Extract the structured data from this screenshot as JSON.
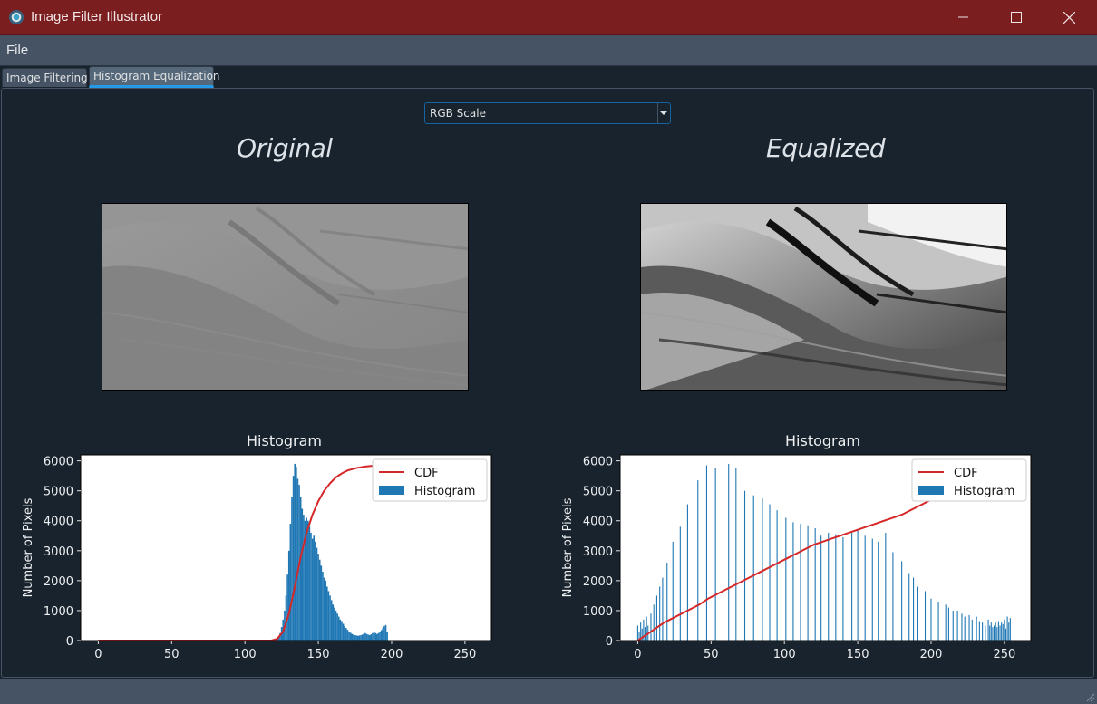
{
  "window": {
    "title": "Image Filter Illustrator"
  },
  "menu": {
    "file": "File"
  },
  "tabs": [
    {
      "label": "Image Filtering",
      "active": false
    },
    {
      "label": "Histogram Equalization",
      "active": true
    }
  ],
  "scale_select": {
    "value": "RGB Scale"
  },
  "panels": {
    "original": {
      "heading": "Original",
      "histogram_title": "Histogram"
    },
    "equalized": {
      "heading": "Equalized",
      "histogram_title": "Histogram"
    }
  },
  "colors": {
    "titlebar": "#7a1e20",
    "accent": "#259ae9",
    "histogram_bar": "#1f77b4",
    "cdf_line": "#d62728"
  },
  "chart_data": [
    {
      "type": "bar",
      "title": "Histogram",
      "xlabel": "",
      "ylabel": "Number of Pixels",
      "xlim": [
        -12,
        268
      ],
      "ylim": [
        0,
        6200
      ],
      "xticks": [
        0,
        50,
        100,
        150,
        200,
        250
      ],
      "yticks": [
        0,
        1000,
        2000,
        3000,
        4000,
        5000,
        6000
      ],
      "legend": {
        "placement": "top-right",
        "entries": [
          "CDF",
          "Histogram"
        ]
      },
      "series": [
        {
          "name": "Histogram",
          "type": "bar",
          "x": [
            121,
            122,
            123,
            124,
            125,
            126,
            127,
            128,
            129,
            130,
            131,
            132,
            133,
            134,
            135,
            136,
            137,
            138,
            139,
            140,
            141,
            142,
            143,
            144,
            145,
            146,
            147,
            148,
            149,
            150,
            151,
            152,
            153,
            154,
            155,
            156,
            157,
            158,
            159,
            160,
            161,
            162,
            163,
            164,
            165,
            166,
            167,
            168,
            169,
            170,
            171,
            172,
            173,
            174,
            175,
            176,
            177,
            178,
            179,
            180,
            181,
            182,
            183,
            184,
            185,
            186,
            187,
            188,
            189,
            190,
            191,
            192,
            193,
            194,
            195,
            196,
            197
          ],
          "y": [
            30,
            60,
            120,
            250,
            450,
            700,
            1000,
            1500,
            2200,
            3000,
            3900,
            4800,
            5500,
            5900,
            5800,
            5400,
            5200,
            4800,
            4400,
            4200,
            4000,
            4100,
            4000,
            3800,
            3600,
            3400,
            3500,
            3300,
            3100,
            2900,
            2700,
            2500,
            2300,
            2100,
            2000,
            1800,
            1650,
            1500,
            1350,
            1200,
            1100,
            1000,
            900,
            800,
            700,
            650,
            560,
            480,
            420,
            360,
            300,
            260,
            220,
            200,
            180,
            170,
            160,
            170,
            180,
            200,
            220,
            250,
            220,
            200,
            180,
            210,
            250,
            280,
            250,
            220,
            250,
            300,
            350,
            420,
            480,
            520,
            300
          ]
        },
        {
          "name": "CDF",
          "type": "line",
          "x": [
            0,
            118,
            122,
            126,
            130,
            134,
            138,
            142,
            146,
            150,
            154,
            158,
            162,
            166,
            170,
            176,
            182,
            190,
            200,
            210,
            255
          ],
          "y": [
            0,
            0,
            60,
            300,
            900,
            1800,
            2800,
            3600,
            4200,
            4650,
            5000,
            5250,
            5450,
            5580,
            5680,
            5760,
            5810,
            5850,
            5880,
            5900,
            5900
          ]
        }
      ]
    },
    {
      "type": "bar",
      "title": "Histogram",
      "xlabel": "",
      "ylabel": "Number of Pixels",
      "xlim": [
        -12,
        268
      ],
      "ylim": [
        0,
        6200
      ],
      "xticks": [
        0,
        50,
        100,
        150,
        200,
        250
      ],
      "yticks": [
        0,
        1000,
        2000,
        3000,
        4000,
        5000,
        6000
      ],
      "legend": {
        "placement": "top-right",
        "entries": [
          "CDF",
          "Histogram"
        ]
      },
      "series": [
        {
          "name": "Histogram",
          "type": "bar",
          "x": [
            0,
            1,
            2,
            3,
            4,
            5,
            6,
            7,
            9,
            11,
            13,
            15,
            17,
            20,
            24,
            29,
            34,
            41,
            47,
            53,
            62,
            67,
            73,
            79,
            85,
            90,
            95,
            101,
            106,
            111,
            116,
            121,
            125,
            130,
            135,
            140,
            146,
            150,
            155,
            160,
            164,
            169,
            174,
            180,
            185,
            188,
            191,
            196,
            200,
            205,
            210,
            212,
            215,
            218,
            221,
            223,
            226,
            228,
            231,
            233,
            235,
            237,
            239,
            240,
            241,
            242,
            243,
            244,
            245,
            246,
            247,
            248,
            249,
            250,
            251,
            252,
            253,
            254
          ],
          "y": [
            500,
            300,
            600,
            400,
            700,
            450,
            800,
            500,
            900,
            1200,
            1500,
            1800,
            2100,
            2600,
            3300,
            3800,
            4550,
            5350,
            5850,
            5750,
            5900,
            5750,
            5000,
            4850,
            4750,
            4550,
            4350,
            4100,
            3950,
            3900,
            3850,
            3750,
            3500,
            3600,
            3550,
            3450,
            3600,
            3700,
            3500,
            3400,
            3300,
            3600,
            2950,
            2650,
            2250,
            2100,
            1800,
            1650,
            1400,
            1300,
            1200,
            1100,
            1000,
            1000,
            900,
            800,
            850,
            700,
            800,
            650,
            600,
            500,
            700,
            500,
            600,
            450,
            500,
            600,
            450,
            650,
            500,
            600,
            550,
            700,
            400,
            800,
            600,
            750
          ]
        },
        {
          "name": "CDF",
          "type": "line",
          "x": [
            0,
            6,
            12,
            18,
            24,
            30,
            36,
            42,
            48,
            54,
            60,
            66,
            72,
            78,
            84,
            90,
            96,
            102,
            108,
            114,
            120,
            126,
            132,
            138,
            144,
            150,
            156,
            162,
            168,
            174,
            180,
            186,
            192,
            198,
            204,
            210,
            216,
            222,
            228,
            234,
            240,
            246,
            252,
            255
          ],
          "y": [
            0,
            200,
            400,
            600,
            750,
            900,
            1050,
            1200,
            1400,
            1550,
            1700,
            1850,
            2000,
            2150,
            2300,
            2450,
            2600,
            2750,
            2900,
            3050,
            3200,
            3300,
            3400,
            3500,
            3600,
            3700,
            3800,
            3900,
            4000,
            4100,
            4200,
            4350,
            4500,
            4650,
            4800,
            4950,
            5100,
            5250,
            5400,
            5550,
            5650,
            5750,
            5850,
            5900
          ]
        }
      ]
    }
  ]
}
